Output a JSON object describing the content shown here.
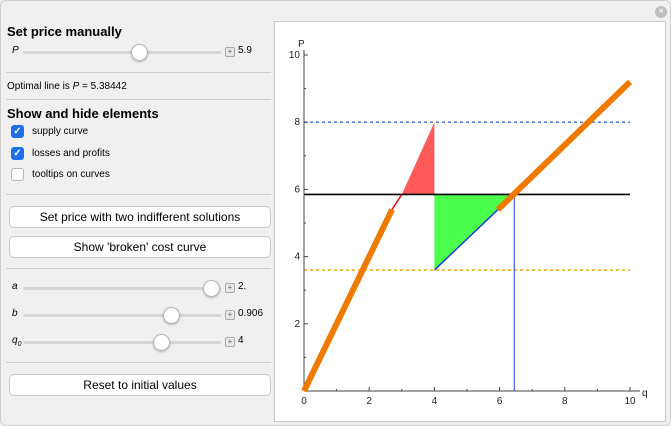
{
  "window": {
    "close_glyph": "×"
  },
  "panel": {
    "manual_heading": "Set price manually",
    "p_slider": {
      "label": "P",
      "value": "5.9",
      "fraction": 0.59
    },
    "optimal_prefix": "Optimal line is ",
    "optimal_var": "P",
    "optimal_value": " = 5.38442",
    "show_heading": "Show and hide elements",
    "checkboxes": [
      {
        "label": "supply curve",
        "checked": true
      },
      {
        "label": "losses and profits",
        "checked": true
      },
      {
        "label": "tooltips on curves",
        "checked": false
      }
    ],
    "btn_two_solutions": "Set price with two indifferent solutions",
    "btn_broken": "Show 'broken' cost curve",
    "a_slider": {
      "label": "a",
      "value": "2.",
      "fraction": 0.95
    },
    "b_slider": {
      "label": "b",
      "value": "0.906",
      "fraction": 0.75
    },
    "q0_slider": {
      "label": "q",
      "sub": "0",
      "value": "4",
      "fraction": 0.7
    },
    "btn_reset": "Reset to initial values",
    "plus_glyph": "+"
  },
  "chart_data": {
    "type": "line",
    "xlabel": "q",
    "ylabel": "P",
    "xlim": [
      0,
      10
    ],
    "ylim": [
      0,
      10
    ],
    "xticks": [
      "0",
      "2",
      "4",
      "6",
      "8",
      "10"
    ],
    "yticks": [
      "2",
      "4",
      "6",
      "8",
      "10"
    ],
    "price_line": 5.85,
    "upper_dashed": 8.0,
    "lower_dashed": 3.6,
    "supply_left": [
      [
        0,
        0
      ],
      [
        2.7,
        5.4
      ]
    ],
    "red_segment": [
      [
        2.7,
        5.4
      ],
      [
        3.0,
        5.85
      ]
    ],
    "supply_right": [
      [
        5.95,
        5.4
      ],
      [
        10,
        9.2
      ]
    ],
    "blue_segment": [
      [
        4.0,
        3.6
      ],
      [
        5.95,
        5.4
      ]
    ],
    "loss_triangle": [
      [
        3.0,
        5.85
      ],
      [
        4.0,
        8.0
      ],
      [
        4.0,
        5.85
      ]
    ],
    "profit_triangle": [
      [
        4.0,
        5.85
      ],
      [
        6.45,
        5.85
      ],
      [
        4.0,
        3.6
      ]
    ],
    "optimal_q": 6.45,
    "colors": {
      "supply": "#f07a00",
      "price": "#000000",
      "upper": "#3b6fd4",
      "lower": "#e0a000",
      "loss": "#ff5a5a",
      "profit": "#4cff4c",
      "blue": "#1a3fe0",
      "red": "#e01010"
    }
  }
}
